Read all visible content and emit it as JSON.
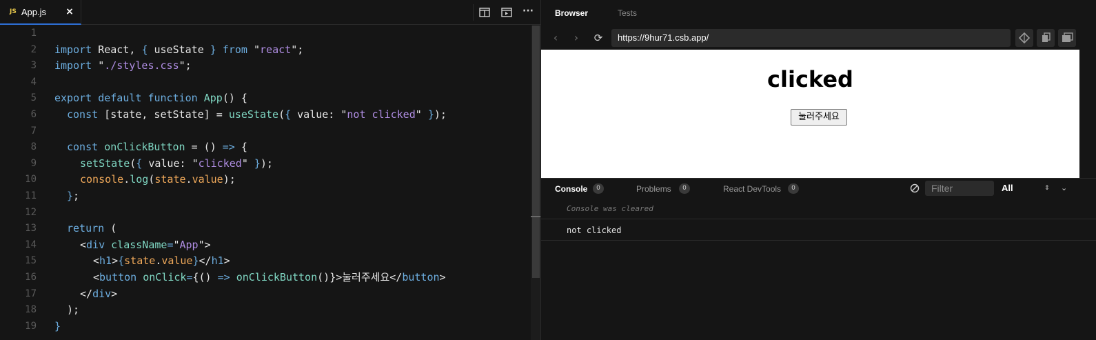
{
  "editor": {
    "tab": {
      "lang_badge": "JS",
      "filename": "App.js",
      "close_glyph": "×"
    },
    "actions": [
      "split-view-icon",
      "preview-icon",
      "more-icon"
    ],
    "more_glyph": "···",
    "lines": [
      {
        "n": "1"
      },
      {
        "n": "2"
      },
      {
        "n": "3"
      },
      {
        "n": "4"
      },
      {
        "n": "5"
      },
      {
        "n": "6"
      },
      {
        "n": "7"
      },
      {
        "n": "8"
      },
      {
        "n": "9"
      },
      {
        "n": "10"
      },
      {
        "n": "11"
      },
      {
        "n": "12"
      },
      {
        "n": "13"
      },
      {
        "n": "14"
      },
      {
        "n": "15"
      },
      {
        "n": "16"
      },
      {
        "n": "17"
      },
      {
        "n": "18"
      },
      {
        "n": "19"
      }
    ],
    "code": {
      "l1": [
        "import",
        " React, ",
        "{",
        " useState ",
        "}",
        " from ",
        "\"",
        "react",
        "\"",
        ";"
      ],
      "l2": [
        "import",
        " \"",
        "./styles.css",
        "\"",
        ";"
      ],
      "l4": [
        "export default function",
        " ",
        "App",
        "() {"
      ],
      "l5": [
        "const",
        " [state, setState] = ",
        "useState",
        "(",
        "{",
        " value: ",
        "\"",
        "not clicked",
        "\"",
        " ",
        "}",
        ");"
      ],
      "l7": [
        "const",
        " ",
        "onClickButton",
        " = () ",
        "=>",
        " {"
      ],
      "l8": [
        "setState",
        "(",
        "{",
        " value: ",
        "\"",
        "clicked",
        "\"",
        " ",
        "}",
        ");"
      ],
      "l9": [
        "console",
        ".",
        "log",
        "(",
        "state",
        ".",
        "value",
        ");"
      ],
      "l10": [
        "}",
        ";"
      ],
      "l12": [
        "return",
        " ("
      ],
      "l13": [
        "<",
        "div",
        " ",
        "className",
        "=",
        "\"",
        "App",
        "\"",
        ">"
      ],
      "l14": [
        "<",
        "h1",
        ">",
        "{",
        "state",
        ".",
        "value",
        "}",
        "</",
        "h1",
        ">"
      ],
      "l15": [
        "<",
        "button",
        " ",
        "onClick",
        "=",
        "{",
        "() ",
        "=>",
        " ",
        "onClickButton",
        "()",
        "}",
        ">",
        "눌러주세요",
        "</",
        "button",
        ">"
      ],
      "l16": [
        "</",
        "div",
        ">"
      ],
      "l17": [
        ");"
      ],
      "l18": [
        "}"
      ]
    }
  },
  "preview": {
    "tabs": [
      "Browser",
      "Tests"
    ],
    "nav": {
      "back": "‹",
      "forward": "›",
      "reload": "⟳"
    },
    "url": "https://9hur71.csb.app/",
    "page": {
      "heading": "clicked",
      "button_label": "눌러주세요"
    }
  },
  "console": {
    "tabs": [
      {
        "label": "Console",
        "count": "0"
      },
      {
        "label": "Problems",
        "count": "0"
      },
      {
        "label": "React DevTools",
        "count": "0"
      }
    ],
    "filter_placeholder": "Filter",
    "level": "All",
    "level_arrow": "⇕",
    "collapse_glyph": "⌄",
    "logs": [
      "Console was cleared",
      "not clicked"
    ]
  },
  "colors": {
    "bg": "#151515",
    "keyword": "#6caddf",
    "function": "#7fd6c2",
    "string": "#b08ee4",
    "variable": "#f0a95a",
    "active_tab_underline": "#2e6fd6"
  }
}
